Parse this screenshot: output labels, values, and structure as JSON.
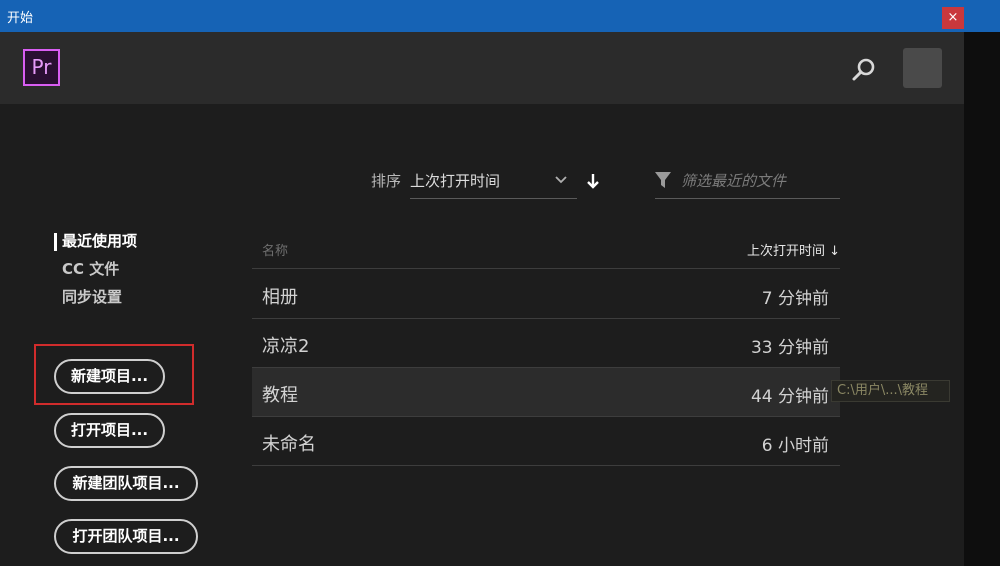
{
  "window": {
    "title": "开始",
    "close_glyph": "×"
  },
  "header": {
    "logo_text": "Pr",
    "search_icon": "search-icon",
    "avatar": "avatar"
  },
  "toolbar": {
    "sort_label": "排序",
    "sort_value": "上次打开时间",
    "filter_placeholder": "筛选最近的文件"
  },
  "nav": {
    "items": [
      "最近使用项",
      "CC 文件",
      "同步设置"
    ]
  },
  "actions": {
    "new_project": "新建项目...",
    "open_project": "打开项目...",
    "new_team_project": "新建团队项目...",
    "open_team_project": "打开团队项目..."
  },
  "list": {
    "col_name": "名称",
    "col_time": "上次打开时间",
    "rows": [
      {
        "name": "相册",
        "time": "7 分钟前"
      },
      {
        "name": "凉凉2",
        "time": "33 分钟前"
      },
      {
        "name": "教程",
        "time": "44 分钟前"
      },
      {
        "name": "未命名",
        "time": "6 小时前"
      }
    ]
  },
  "tooltip": {
    "text": "C:\\用户\\...\\教程"
  },
  "colors": {
    "titlebar": "#1663b5",
    "premiere_magenta": "#d95ef3",
    "highlight_red": "#d12c2c"
  }
}
